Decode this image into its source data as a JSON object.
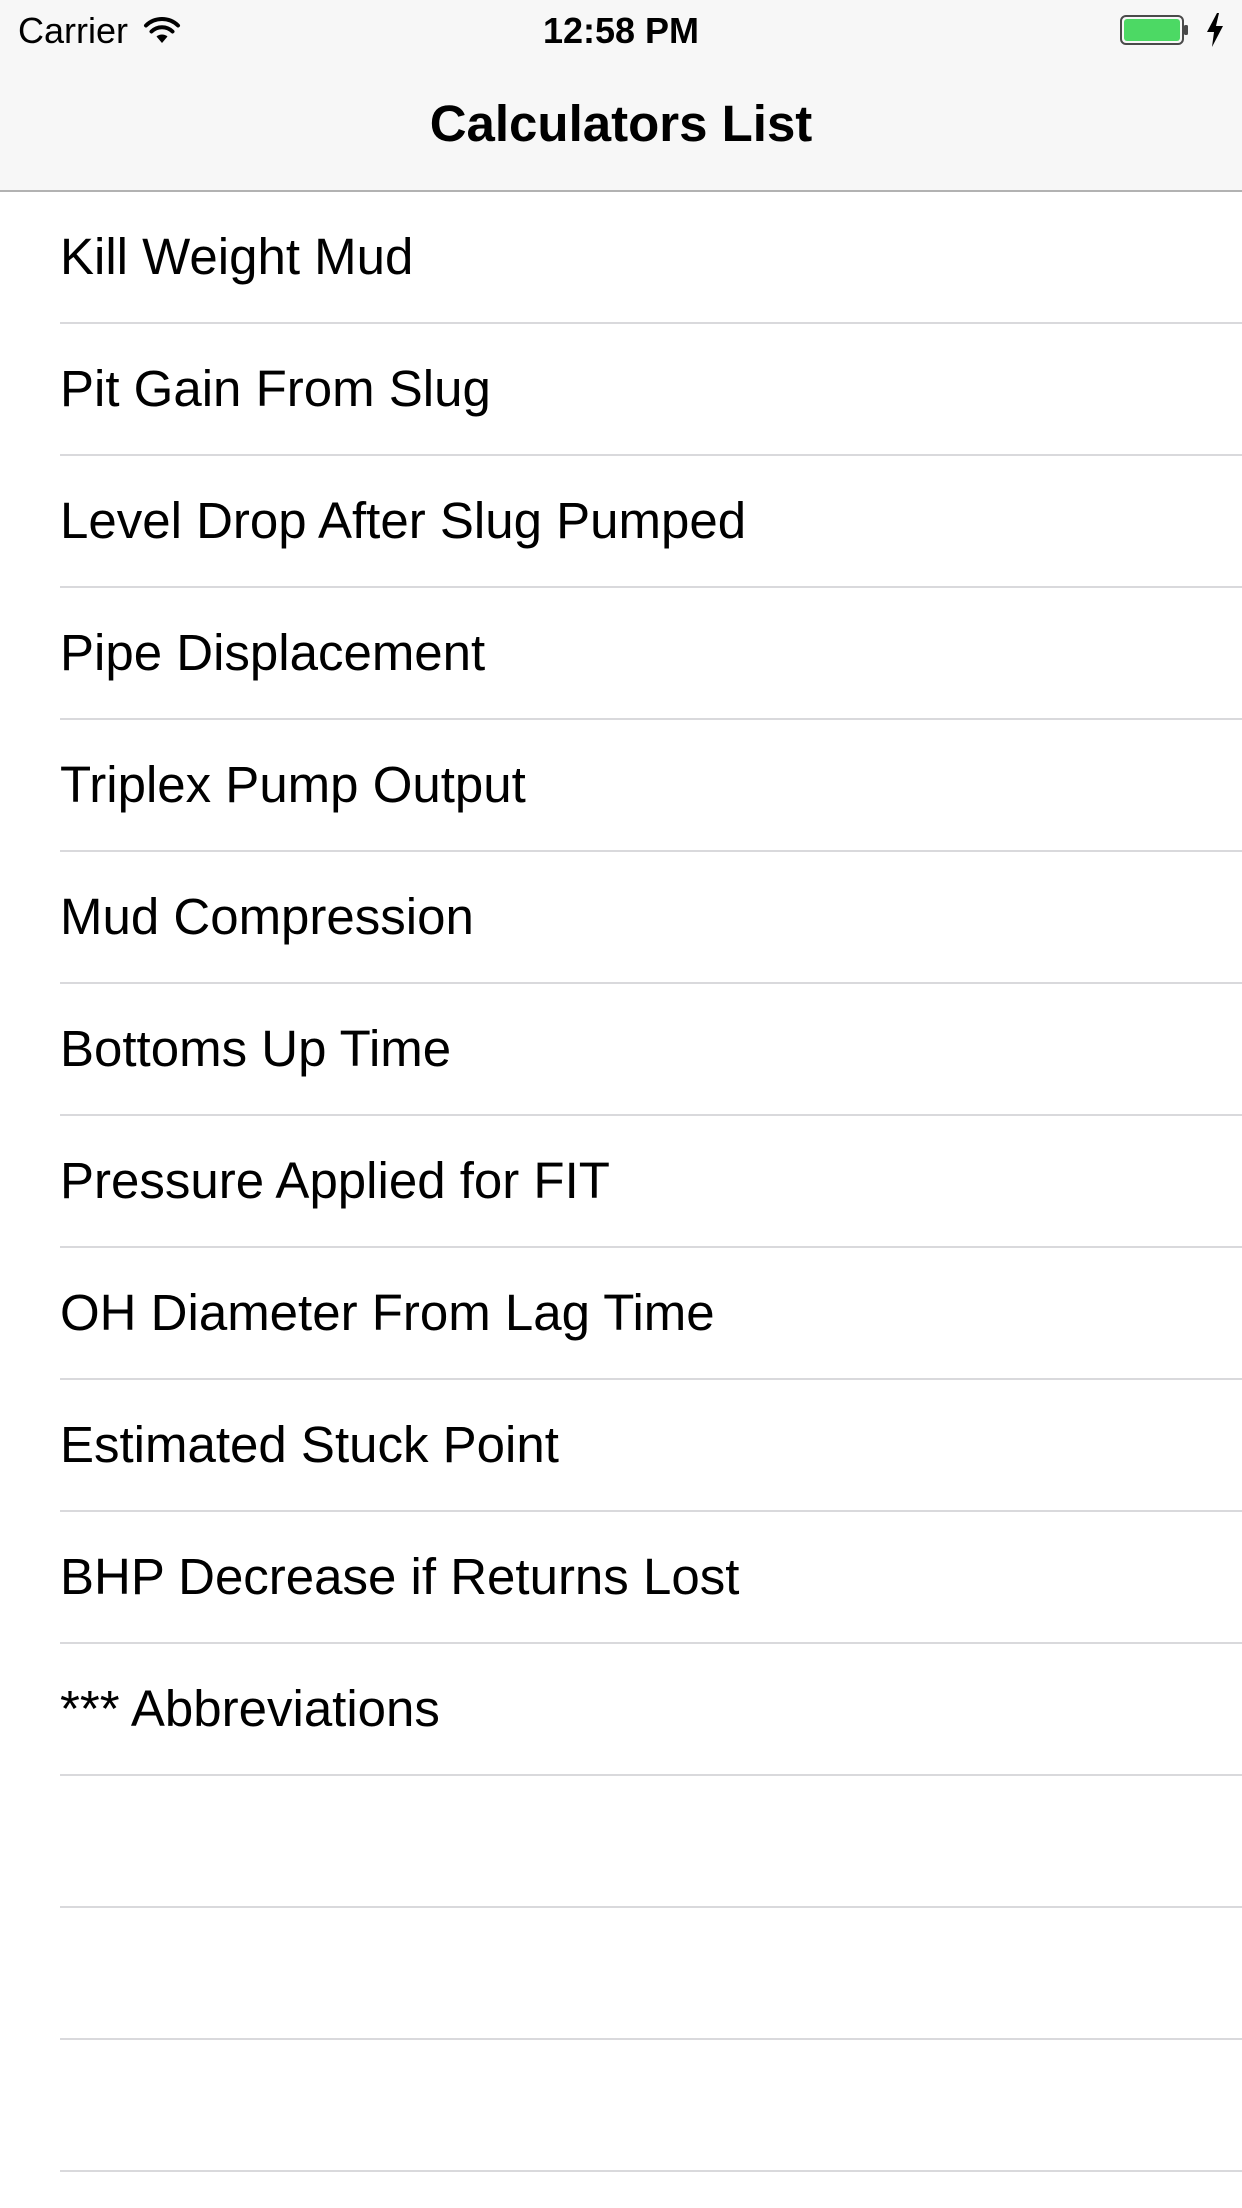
{
  "status_bar": {
    "carrier": "Carrier",
    "time": "12:58 PM",
    "battery_color": "#4cd964"
  },
  "nav_bar": {
    "title": "Calculators List"
  },
  "list": {
    "items": [
      "Kill Weight Mud",
      "Pit Gain From Slug",
      "Level Drop After Slug Pumped",
      "Pipe Displacement",
      "Triplex Pump Output",
      "Mud Compression",
      "Bottoms Up Time",
      "Pressure Applied for FIT",
      "OH Diameter From Lag Time",
      "Estimated Stuck Point",
      "BHP Decrease if Returns Lost",
      "*** Abbreviations"
    ],
    "empty_rows": 3
  },
  "icons": {
    "wifi": "wifi-icon",
    "battery": "battery-icon",
    "charging": "charging-bolt-icon"
  }
}
